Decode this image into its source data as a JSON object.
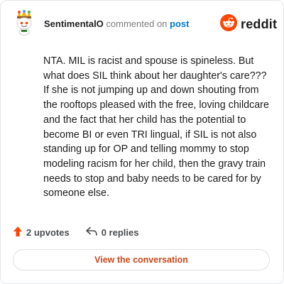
{
  "header": {
    "username": "SentimentalO",
    "verb": "commented on",
    "target": "post",
    "brand": "reddit",
    "avatar_icon": "snoo-avatar-icon",
    "brand_icon": "reddit-logo-icon"
  },
  "comment": {
    "text": "NTA. MIL is racist and spouse is spineless. But what does SIL think about her daughter's care??? If she is not jumping up and down shouting from the rooftops pleased with the free, loving childcare and the fact that her child has the potential to become BI or even TRI lingual, if SIL is not also standing up for OP and telling mommy to stop modeling racism for her child, then the gravy train needs to stop and baby needs to be cared for by someone else."
  },
  "footer": {
    "upvotes": "2 upvotes",
    "replies": "0 replies",
    "upvote_icon": "upvote-arrow-icon",
    "reply_icon": "reply-arrow-icon"
  },
  "cta": {
    "label": "View the conversation"
  },
  "colors": {
    "accent": "#ff4500",
    "link": "#0079d3",
    "cta_text": "#c8471b"
  }
}
